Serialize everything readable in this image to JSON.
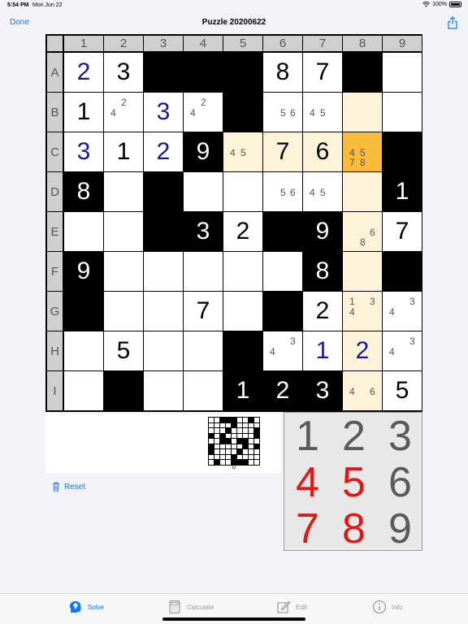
{
  "status": {
    "time": "5:54 PM",
    "date": "Mon Jun 22",
    "battery": "100%"
  },
  "nav": {
    "done_label": "Done",
    "title": "Puzzle 20200622",
    "share_icon": "share-icon"
  },
  "board": {
    "col_labels": [
      "1",
      "2",
      "3",
      "4",
      "5",
      "6",
      "7",
      "8",
      "9"
    ],
    "row_labels": [
      "A",
      "B",
      "C",
      "D",
      "E",
      "F",
      "G",
      "H",
      "I"
    ],
    "colors": {
      "black": "#000000",
      "highlight": "#fdf3d8",
      "selected": "#f8bb3a",
      "user_digit": "#17179d",
      "header": "#cfcfcf"
    },
    "cells": [
      [
        {
          "t": "w",
          "v": "2",
          "s": "user"
        },
        {
          "t": "w",
          "v": "3",
          "s": "given"
        },
        {
          "t": "b"
        },
        {
          "t": "b"
        },
        {
          "t": "b"
        },
        {
          "t": "w",
          "v": "8",
          "s": "given"
        },
        {
          "t": "w",
          "v": "7",
          "s": "given"
        },
        {
          "t": "b"
        },
        {
          "t": "w"
        }
      ],
      [
        {
          "t": "w",
          "v": "1",
          "s": "given"
        },
        {
          "t": "w",
          "pm": "4 2"
        },
        {
          "t": "w",
          "v": "3",
          "s": "user"
        },
        {
          "t": "w",
          "pm": "4 2"
        },
        {
          "t": "b"
        },
        {
          "t": "w",
          "pm": "5 6"
        },
        {
          "t": "w",
          "pm": "4 5"
        },
        {
          "t": "h"
        },
        {
          "t": "w"
        }
      ],
      [
        {
          "t": "w",
          "v": "3",
          "s": "user"
        },
        {
          "t": "w",
          "v": "1",
          "s": "given"
        },
        {
          "t": "w",
          "v": "2",
          "s": "user"
        },
        {
          "t": "b",
          "v": "9",
          "s": "onblack"
        },
        {
          "t": "h",
          "pm": "4 5"
        },
        {
          "t": "h",
          "v": "7",
          "s": "given"
        },
        {
          "t": "h",
          "v": "6",
          "s": "given"
        },
        {
          "t": "s",
          "pm": "4 5 7 8"
        },
        {
          "t": "b"
        }
      ],
      [
        {
          "t": "b",
          "v": "8",
          "s": "onblack"
        },
        {
          "t": "w"
        },
        {
          "t": "b"
        },
        {
          "t": "w"
        },
        {
          "t": "w"
        },
        {
          "t": "w",
          "pm": "5 6"
        },
        {
          "t": "w",
          "pm": "4 5"
        },
        {
          "t": "h"
        },
        {
          "t": "b",
          "v": "1",
          "s": "onblack"
        }
      ],
      [
        {
          "t": "w"
        },
        {
          "t": "w"
        },
        {
          "t": "b"
        },
        {
          "t": "b",
          "v": "3",
          "s": "onblack"
        },
        {
          "t": "w",
          "v": "2",
          "s": "given"
        },
        {
          "t": "b"
        },
        {
          "t": "b",
          "v": "9",
          "s": "onblack"
        },
        {
          "t": "h",
          "pm": "8 6"
        },
        {
          "t": "w",
          "v": "7",
          "s": "given"
        }
      ],
      [
        {
          "t": "b",
          "v": "9",
          "s": "onblack"
        },
        {
          "t": "w"
        },
        {
          "t": "w"
        },
        {
          "t": "w"
        },
        {
          "t": "w"
        },
        {
          "t": "w"
        },
        {
          "t": "b",
          "v": "8",
          "s": "onblack"
        },
        {
          "t": "h"
        },
        {
          "t": "b"
        }
      ],
      [
        {
          "t": "b"
        },
        {
          "t": "w"
        },
        {
          "t": "w"
        },
        {
          "t": "w",
          "v": "7",
          "s": "given"
        },
        {
          "t": "w"
        },
        {
          "t": "b"
        },
        {
          "t": "w",
          "v": "2",
          "s": "given"
        },
        {
          "t": "h",
          "pm": "1 3 4"
        },
        {
          "t": "w",
          "pm": "4 3"
        }
      ],
      [
        {
          "t": "w"
        },
        {
          "t": "w",
          "v": "5",
          "s": "given"
        },
        {
          "t": "w"
        },
        {
          "t": "w"
        },
        {
          "t": "b"
        },
        {
          "t": "w",
          "pm": "4 3"
        },
        {
          "t": "w",
          "v": "1",
          "s": "user"
        },
        {
          "t": "h",
          "v": "2",
          "s": "user"
        },
        {
          "t": "w",
          "pm": "4 3"
        }
      ],
      [
        {
          "t": "w"
        },
        {
          "t": "b"
        },
        {
          "t": "w"
        },
        {
          "t": "w"
        },
        {
          "t": "b",
          "v": "1",
          "s": "onblack"
        },
        {
          "t": "b",
          "v": "2",
          "s": "onblack"
        },
        {
          "t": "b",
          "v": "3",
          "s": "onblack"
        },
        {
          "t": "h",
          "pm": "4 6"
        },
        {
          "t": "w",
          "v": "5",
          "s": "given"
        }
      ]
    ]
  },
  "thumbnail": {
    "label": "0"
  },
  "reset": {
    "label": "Reset",
    "icon": "trash-icon"
  },
  "keypad": {
    "keys": [
      {
        "d": "1",
        "color": "gray"
      },
      {
        "d": "2",
        "color": "gray"
      },
      {
        "d": "3",
        "color": "gray"
      },
      {
        "d": "4",
        "color": "red"
      },
      {
        "d": "5",
        "color": "red"
      },
      {
        "d": "6",
        "color": "gray"
      },
      {
        "d": "7",
        "color": "red"
      },
      {
        "d": "8",
        "color": "red"
      },
      {
        "d": "9",
        "color": "gray"
      }
    ]
  },
  "tabs": [
    {
      "label": "Solve",
      "icon": "head-bulb-icon",
      "active": true
    },
    {
      "label": "Calculate",
      "icon": "calculator-icon",
      "active": false
    },
    {
      "label": "Edit",
      "icon": "edit-icon",
      "active": false
    },
    {
      "label": "Info",
      "icon": "info-icon",
      "active": false
    }
  ]
}
